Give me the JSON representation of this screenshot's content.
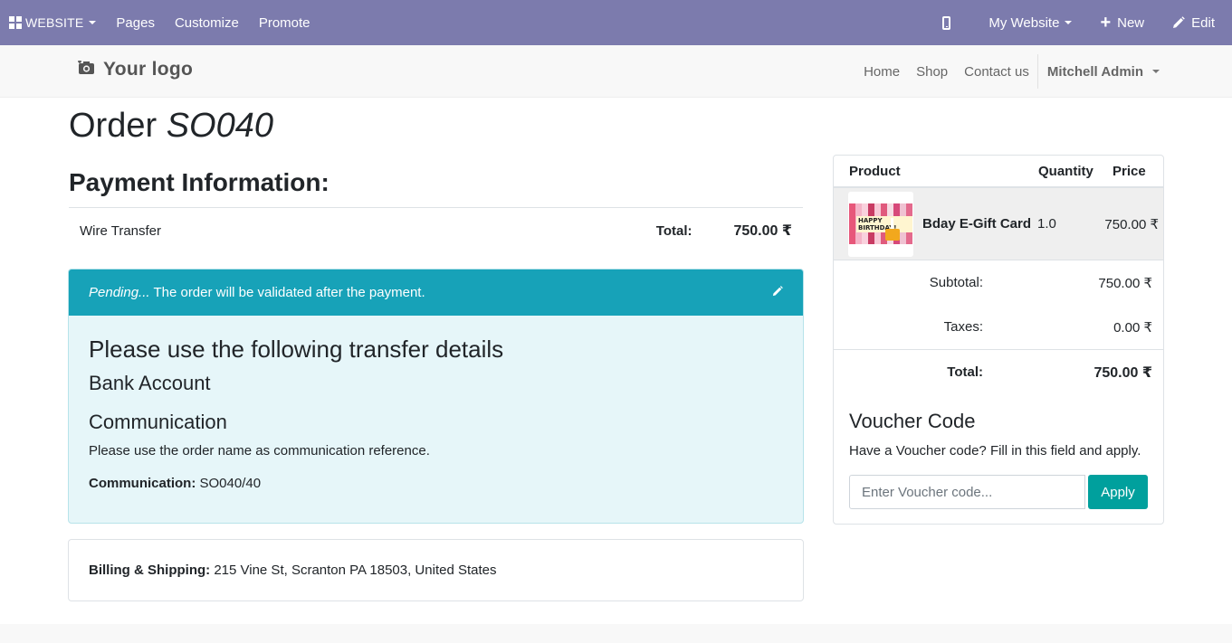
{
  "topbar": {
    "website_label": "WEBSITE",
    "menu": [
      "Pages",
      "Customize",
      "Promote"
    ],
    "site_selector": "My Website",
    "new_label": "New",
    "edit_label": "Edit",
    "icons": {
      "apps": "grid-icon",
      "mobile": "mobile-preview-icon",
      "new": "plus-icon",
      "edit": "pencil-icon"
    },
    "background_color": "#7c7bad"
  },
  "header": {
    "logo_text": "Your logo",
    "logo_icon": "camera-icon",
    "nav": [
      "Home",
      "Shop",
      "Contact us"
    ],
    "user": "Mitchell Admin"
  },
  "order": {
    "title_prefix": "Order",
    "name": "SO040"
  },
  "payment": {
    "heading": "Payment Information:",
    "method": "Wire Transfer",
    "total_label": "Total:",
    "total_value": "750.00 ₹"
  },
  "alert": {
    "status_italic": "Pending...",
    "status_text": " The order will be validated after the payment.",
    "edit_icon": "pencil-icon",
    "heading": "Please use the following transfer details",
    "bank_heading": "Bank Account",
    "comm_heading": "Communication",
    "comm_instruction": "Please use the order name as communication reference.",
    "comm_label": "Communication:",
    "comm_value": " SO040/40",
    "header_color": "#17a2b8",
    "body_color": "#e6f6f9"
  },
  "billing": {
    "label": "Billing & Shipping:",
    "address": " 215 Vine St, Scranton PA 18503, United States"
  },
  "cart": {
    "headers": {
      "product": "Product",
      "quantity": "Quantity",
      "price": "Price"
    },
    "lines": [
      {
        "name": "Bday E-Gift Card",
        "quantity": "1.0",
        "price": "750.00 ₹",
        "thumb_text": "HAPPY BIRTHDAY!"
      }
    ],
    "subtotal_label": "Subtotal:",
    "subtotal_value": "750.00 ₹",
    "taxes_label": "Taxes:",
    "taxes_value": "0.00 ₹",
    "total_label": "Total:",
    "total_value": "750.00 ₹"
  },
  "voucher": {
    "heading": "Voucher Code",
    "description": "Have a Voucher code? Fill in this field and apply.",
    "input_value": "",
    "placeholder": "Enter Voucher code...",
    "apply_label": "Apply",
    "button_color": "#00a09d"
  }
}
